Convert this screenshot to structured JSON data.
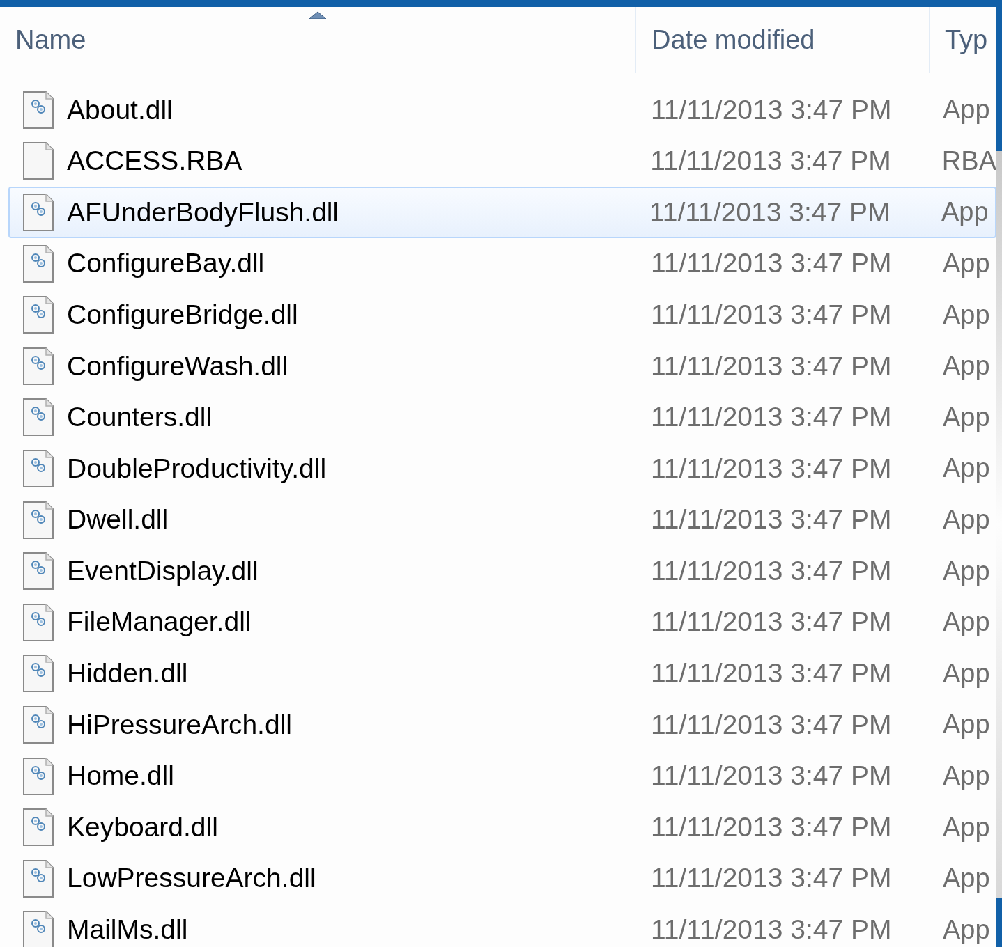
{
  "columns": [
    {
      "label": "Name",
      "sorted": true
    },
    {
      "label": "Date modified",
      "sorted": false
    },
    {
      "label": "Typ",
      "sorted": false
    }
  ],
  "files": [
    {
      "name": "About.dll",
      "date": "11/11/2013 3:47 PM",
      "type": "App",
      "kind": "dll",
      "selected": false
    },
    {
      "name": "ACCESS.RBA",
      "date": "11/11/2013 3:47 PM",
      "type": "RBA",
      "kind": "blank",
      "selected": false
    },
    {
      "name": "AFUnderBodyFlush.dll",
      "date": "11/11/2013 3:47 PM",
      "type": "App",
      "kind": "dll",
      "selected": true
    },
    {
      "name": "ConfigureBay.dll",
      "date": "11/11/2013 3:47 PM",
      "type": "App",
      "kind": "dll",
      "selected": false
    },
    {
      "name": "ConfigureBridge.dll",
      "date": "11/11/2013 3:47 PM",
      "type": "App",
      "kind": "dll",
      "selected": false
    },
    {
      "name": "ConfigureWash.dll",
      "date": "11/11/2013 3:47 PM",
      "type": "App",
      "kind": "dll",
      "selected": false
    },
    {
      "name": "Counters.dll",
      "date": "11/11/2013 3:47 PM",
      "type": "App",
      "kind": "dll",
      "selected": false
    },
    {
      "name": "DoubleProductivity.dll",
      "date": "11/11/2013 3:47 PM",
      "type": "App",
      "kind": "dll",
      "selected": false
    },
    {
      "name": "Dwell.dll",
      "date": "11/11/2013 3:47 PM",
      "type": "App",
      "kind": "dll",
      "selected": false
    },
    {
      "name": "EventDisplay.dll",
      "date": "11/11/2013 3:47 PM",
      "type": "App",
      "kind": "dll",
      "selected": false
    },
    {
      "name": "FileManager.dll",
      "date": "11/11/2013 3:47 PM",
      "type": "App",
      "kind": "dll",
      "selected": false
    },
    {
      "name": "Hidden.dll",
      "date": "11/11/2013 3:47 PM",
      "type": "App",
      "kind": "dll",
      "selected": false
    },
    {
      "name": "HiPressureArch.dll",
      "date": "11/11/2013 3:47 PM",
      "type": "App",
      "kind": "dll",
      "selected": false
    },
    {
      "name": "Home.dll",
      "date": "11/11/2013 3:47 PM",
      "type": "App",
      "kind": "dll",
      "selected": false
    },
    {
      "name": "Keyboard.dll",
      "date": "11/11/2013 3:47 PM",
      "type": "App",
      "kind": "dll",
      "selected": false
    },
    {
      "name": "LowPressureArch.dll",
      "date": "11/11/2013 3:47 PM",
      "type": "App",
      "kind": "dll",
      "selected": false
    },
    {
      "name": "MailMs.dll",
      "date": "11/11/2013 3:47 PM",
      "type": "App",
      "kind": "dll",
      "selected": false
    }
  ]
}
